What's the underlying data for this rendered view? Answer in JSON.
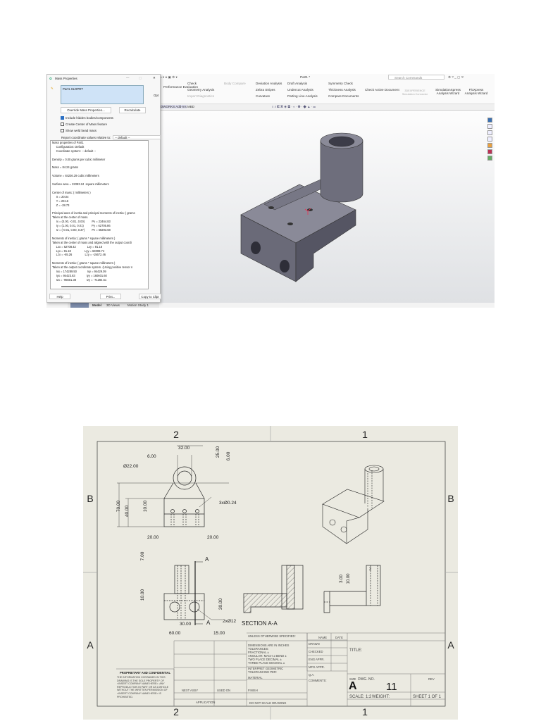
{
  "solidworks": {
    "window_title": "Part1 *",
    "search_placeholder": "Search Commands",
    "ribbon": {
      "performance_evaluation": "Performance Evaluation",
      "check": "Check",
      "geometry_analysis": "Geometry Analysis",
      "import_diagnostics": "Import Diagnostics",
      "body_compare": "Body Compare",
      "deviation_analysis": "Deviation Analysis",
      "zebra_stripes": "Zebra Stripes",
      "curvature": "Curvature",
      "draft_analysis": "Draft Analysis",
      "undercut_analysis": "Undercut Analysis",
      "parting_line_analysis": "Parting Line Analysis",
      "symmetry_check": "Symmetry Check",
      "thickness_analysis": "Thickness Analysis",
      "compare_documents": "Compare Documents",
      "check_active_document": "Check Active Document",
      "simulation_connector": "3DEXPERIENCE Simulation Connector",
      "simulationxpress": "SimulationXpress Analysis Wizard",
      "floxpress": "FloXpress Analysis Wizard"
    },
    "command_tabs": [
      "DWORKS Add-Ins",
      "MBD"
    ],
    "bottom_tabs": [
      "Model",
      "3D Views",
      "Motion Study 1"
    ],
    "mass_dialog": {
      "title": "Mass Properties",
      "selected": "Part1.SLDPRT",
      "options_button": "Opt",
      "override_button": "Override Mass Properties...",
      "recalculate_button": "Recalculate",
      "include_hidden": "Include hidden bodies/components",
      "create_com": "Create Center of Mass feature",
      "show_weld": "Show weld bead mass",
      "report_label": "Report coordinate values relative to:",
      "report_value": "-- default --",
      "results": [
        "Mass properties of Part1",
        "     Configuration: Default",
        "     Coordinate system: -- default --",
        "",
        "Density = 0.00 grams per cubic millimeter",
        "",
        "Mass = 84.24 grams",
        "",
        "Volume = 84236.29 cubic millimeters",
        "",
        "Surface area = 22393.24  square millimeters",
        "",
        "Center of mass: ( millimeters )",
        "     X = 20.04",
        "     Y = 28.16",
        "     Z = -28.73",
        "",
        "Principal axes of inertia and principal moments of inertia: ( grams",
        "Taken at the center of mass.",
        "     Ix = (0.00, -0.01, 0.00)         Px = 23464.83",
        "     Iy = (1.00, 0.01, 0.01)          Py = 62705.86",
        "     Iz = (-0.01, 0.00, 0.37)         Pz = 68293.68",
        "",
        "Moments of inertia: ( grams * square millimeters )",
        "Taken at the center of mass and aligned with the output coordi",
        "     Lxx = 62708.42              Lxy = 91.18",
        "     Lyx = 91.18                 Lyy = 63008.74",
        "     Lzx = -65.26                Lzy = -15672.46",
        "",
        "Moments of inertia: ( grams * square millimeters )",
        "Taken at the output coordinate system. (Using positive tensor n",
        "     Ixx = 174289.50             Ixy = 94429.09",
        "     Iyx = 94423.83              Iyy = 160601.60",
        "     Izx = -95601.38             Izy = -71284.51"
      ],
      "help_button": "Help",
      "print_button": "Print...",
      "copy_button": "Copy to Clipt"
    }
  },
  "drawing": {
    "zones_top": [
      "2",
      "1"
    ],
    "zones_side": [
      "B",
      "A"
    ],
    "dims": {
      "d32": "32.00",
      "d6a": "6.00",
      "d25": "25.00",
      "d6b": "6.00",
      "dia22": "Ø22.00",
      "d70": "70.00",
      "d40": "40.00",
      "d10a": "10.00",
      "holes3": "3xØ0.24",
      "d20a": "20.00",
      "d20b": "20.00",
      "d7": "7.00",
      "d10b": "10.00",
      "d30v": "30.00",
      "d30h": "30.00",
      "d60": "60.00",
      "d15": "15.00",
      "holes2": "2xØ12",
      "d3": "3.00",
      "d10c": "10.00",
      "d2": "2"
    },
    "section_marker": "A",
    "section_label": "SECTION A-A",
    "title_block": {
      "unless": "UNLESS OTHERWISE SPECIFIED:",
      "name": "NAME",
      "date": "DATE",
      "dims_in": "DIMENSIONS ARE IN INCHES",
      "tolerances": "TOLERANCES:",
      "fractional": "FRACTIONAL ±",
      "angular": "ANGULAR: MACH ±    BEND ±",
      "two_place": "TWO PLACE DECIMAL    ±",
      "three_place": "THREE PLACE DECIMAL  ±",
      "interpret": "INTERPRET GEOMETRIC TOLERANCING PER:",
      "material": "MATERIAL",
      "finish": "FINISH",
      "drawn": "DRAWN",
      "checked": "CHECKED",
      "eng_appr": "ENG APPR.",
      "mfg_appr": "MFG APPR.",
      "qa": "Q.A.",
      "comments": "COMMENTS:",
      "title": "TITLE:",
      "size_label": "SIZE",
      "size": "A",
      "dwg_no_label": "DWG.  NO.",
      "dwg_no": "11",
      "rev": "REV",
      "scale": "SCALE: 1:2",
      "weight": "WEIGHT:",
      "sheet": "SHEET 1 OF 1",
      "next_assy": "NEXT ASSY",
      "used_on": "USED ON",
      "application": "APPLICATION",
      "do_not_scale": "DO NOT SCALE DRAWING",
      "proprietary_title": "PROPRIETARY AND CONFIDENTIAL",
      "proprietary_text": [
        "THE INFORMATION CONTAINED IN THIS",
        "DRAWING IS THE SOLE PROPERTY OF",
        "<INSERT COMPANY NAME HERE>. ANY",
        "REPRODUCTION IN PART OR AS A WHOLE",
        "WITHOUT THE WRITTEN PERMISSION OF",
        "<INSERT COMPANY NAME HERE> IS",
        "PROHIBITED."
      ]
    }
  }
}
